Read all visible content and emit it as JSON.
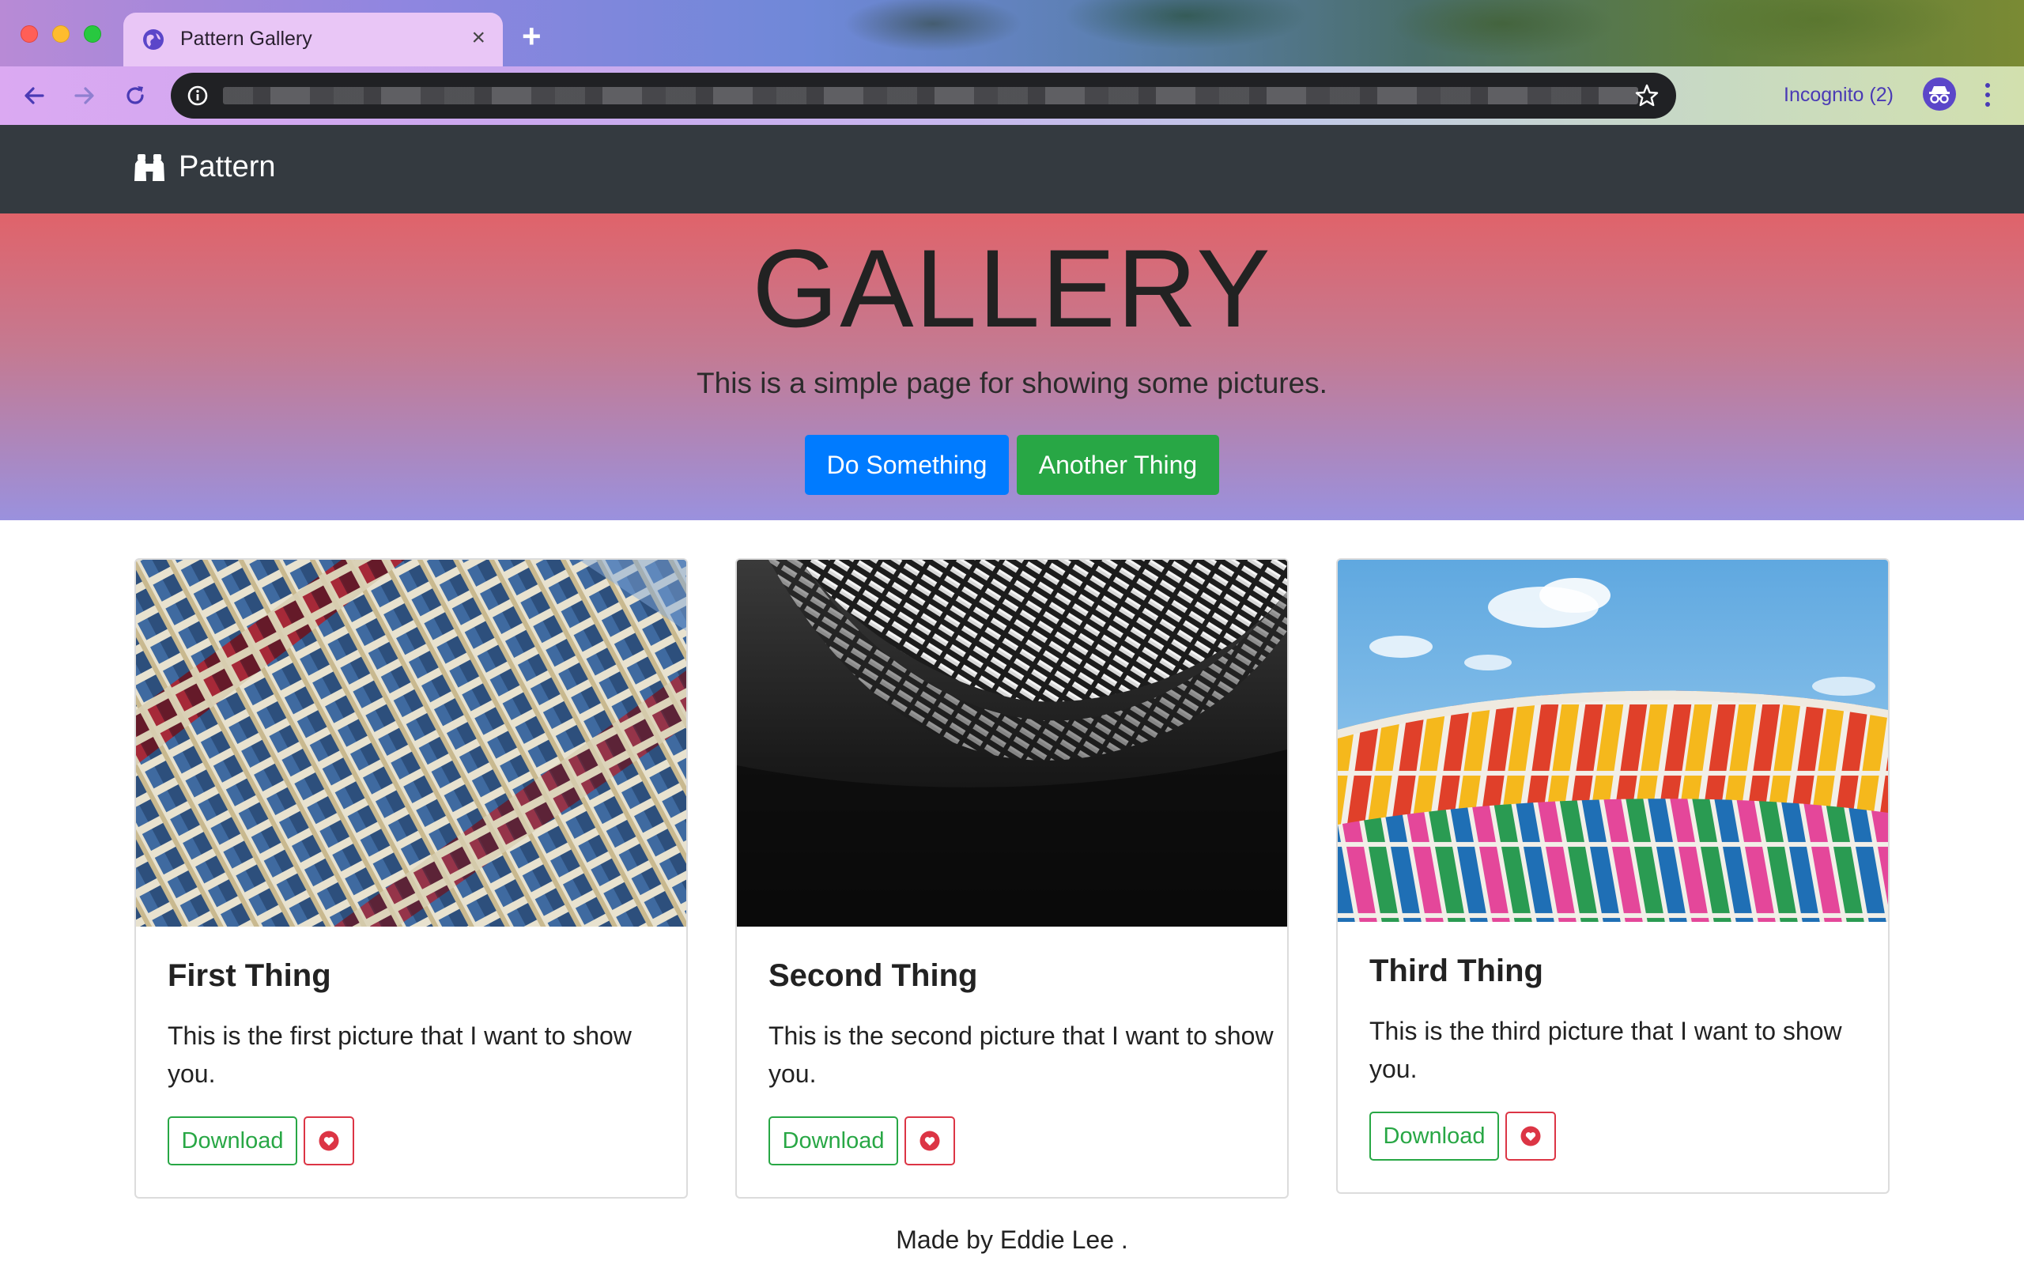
{
  "browser": {
    "tab_title": "Pattern Gallery",
    "tab_icon": "globe-icon",
    "new_tab_label": "+",
    "close_tab_label": "×",
    "incognito_label": "Incognito (2)",
    "url_blurred": true
  },
  "navbar": {
    "brand_icon": "binoculars-icon",
    "brand_text": "Pattern",
    "background": "#343a40"
  },
  "hero": {
    "title": "GALLERY",
    "lead": "This is a simple page for showing some pictures.",
    "primary_button": "Do Something",
    "secondary_button": "Another Thing",
    "gradient_top": "#e0636a",
    "gradient_bottom": "#9a91de"
  },
  "cards": [
    {
      "title": "First Thing",
      "text": "This is the first picture that I want to show you.",
      "download_label": "Download",
      "like_icon": "heart-icon",
      "image": "blue-red-building-facade"
    },
    {
      "title": "Second Thing",
      "text": "This is the second picture that I want to show you.",
      "download_label": "Download",
      "like_icon": "heart-icon",
      "image": "black-white-wave-architecture"
    },
    {
      "title": "Third Thing",
      "text": "This is the third picture that I want to show you.",
      "download_label": "Download",
      "like_icon": "heart-icon",
      "image": "colorful-panels-sky"
    }
  ],
  "footer": {
    "text": "Made by Eddie Lee ."
  },
  "colors": {
    "primary": "#007bff",
    "success": "#28a745",
    "danger": "#dc3545"
  }
}
